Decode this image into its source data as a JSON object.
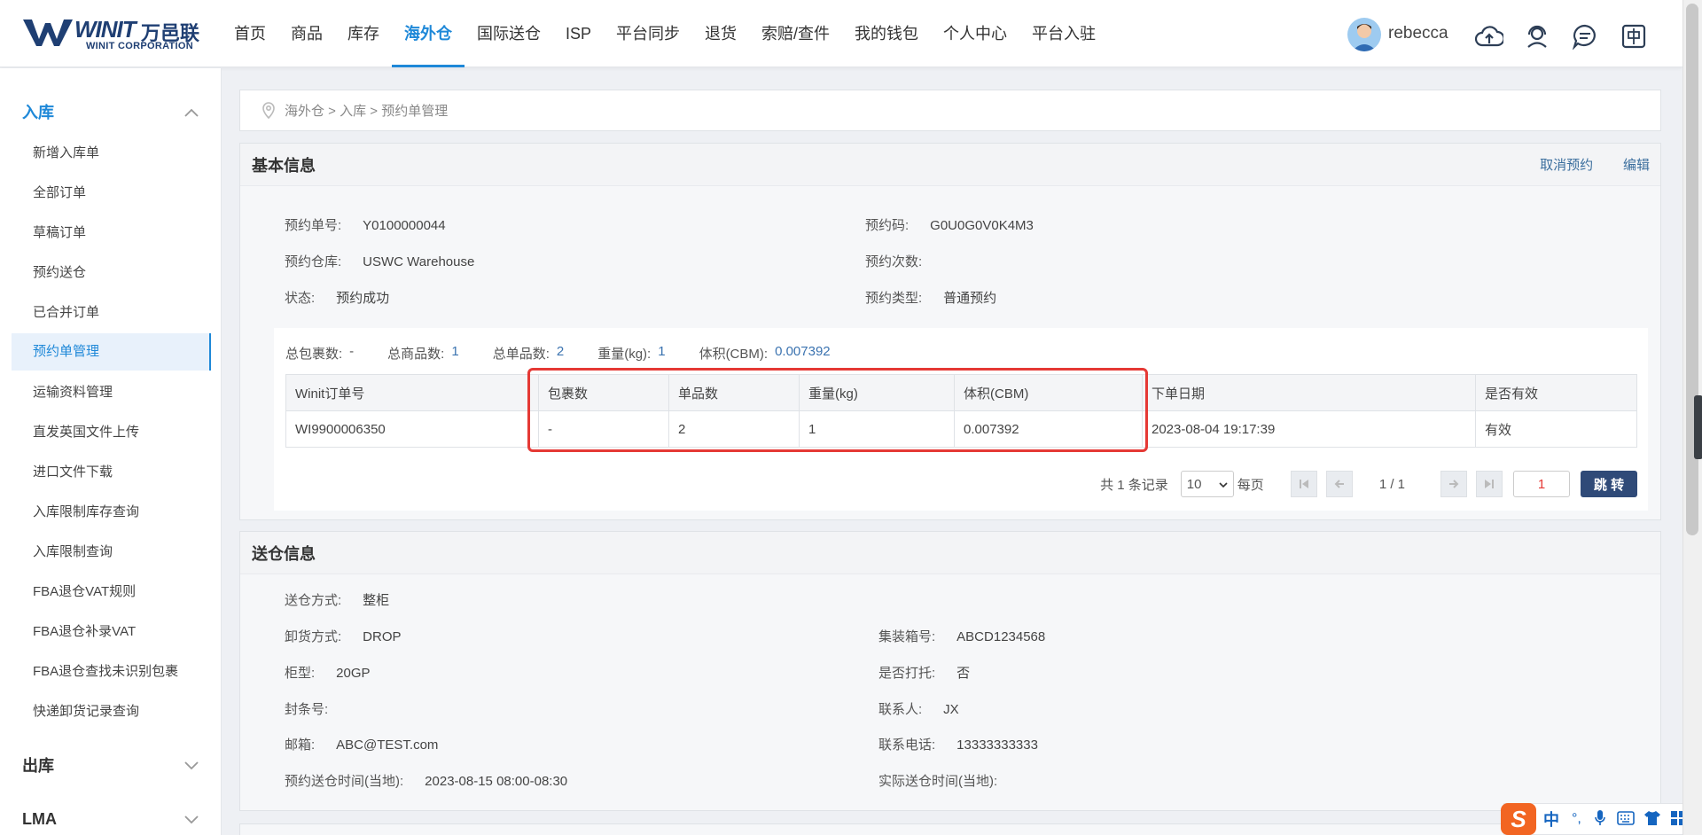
{
  "brand": {
    "name_cn": "万邑联",
    "name_en": "WINIT CORPORATION",
    "mark": "WINIT"
  },
  "nav": [
    "首页",
    "商品",
    "库存",
    "海外仓",
    "国际送仓",
    "ISP",
    "平台同步",
    "退货",
    "索赔/查件",
    "我的钱包",
    "个人中心",
    "平台入驻"
  ],
  "user": {
    "name": "rebecca"
  },
  "sidebar": {
    "inbound": {
      "title": "入库",
      "items": [
        "新增入库单",
        "全部订单",
        "草稿订单",
        "预约送仓",
        "已合并订单",
        "预约单管理",
        "运输资料管理",
        "直发英国文件上传",
        "进口文件下载",
        "入库限制库存查询",
        "入库限制查询",
        "FBA退仓VAT规则",
        "FBA退仓补录VAT",
        "FBA退仓查找未识别包裹",
        "快递卸货记录查询"
      ]
    },
    "outbound": {
      "title": "出库"
    },
    "lma": {
      "title": "LMA"
    }
  },
  "breadcrumb": "海外仓 > 入库 > 预约单管理",
  "basic": {
    "title": "基本信息",
    "cancel": "取消预约",
    "edit": "编辑",
    "order_no_label": "预约单号:",
    "order_no": "Y0100000044",
    "code_label": "预约码:",
    "code": "G0U0G0V0K4M3",
    "warehouse_label": "预约仓库:",
    "warehouse": "USWC Warehouse",
    "times_label": "预约次数:",
    "status_label": "状态:",
    "status": "预约成功",
    "type_label": "预约类型:",
    "type": "普通预约"
  },
  "summary": {
    "packages_label": "总包裹数:",
    "packages": "-",
    "goods_label": "总商品数:",
    "goods": "1",
    "items_label": "总单品数:",
    "items": "2",
    "weight_label": "重量(kg):",
    "weight": "1",
    "volume_label": "体积(CBM):",
    "volume": "0.007392"
  },
  "table": {
    "headers": [
      "Winit订单号",
      "包裹数",
      "单品数",
      "重量(kg)",
      "体积(CBM)",
      "下单日期",
      "是否有效"
    ],
    "row": [
      "WI9900006350",
      "-",
      "2",
      "1",
      "0.007392",
      "2023-08-04 19:17:39",
      "有效"
    ]
  },
  "pager": {
    "total": "共 1 条记录",
    "size": "10",
    "per_page": "每页",
    "page": "1 / 1",
    "jump_value": "1",
    "jump": "跳 转"
  },
  "delivery": {
    "title": "送仓信息",
    "mode_label": "送仓方式:",
    "mode": "整柜",
    "unload_label": "卸货方式:",
    "unload": "DROP",
    "container_label": "集装箱号:",
    "container": "ABCD1234568",
    "cabinet_label": "柜型:",
    "cabinet": "20GP",
    "pallet_label": "是否打托:",
    "pallet": "否",
    "seal_label": "封条号:",
    "contact_label": "联系人:",
    "contact": "JX",
    "email_label": "邮箱:",
    "email": "ABC@TEST.com",
    "phone_label": "联系电话:",
    "phone": "13333333333",
    "planned_label": "预约送仓时间(当地):",
    "planned": "2023-08-15 08:00-08:30",
    "actual_label": "实际送仓时间(当地):"
  },
  "ime": {
    "lang": "中",
    "logo": "S"
  },
  "colors": {
    "accent": "#1e88d8",
    "highlight": "#e53935",
    "link": "#3c6f9e"
  }
}
